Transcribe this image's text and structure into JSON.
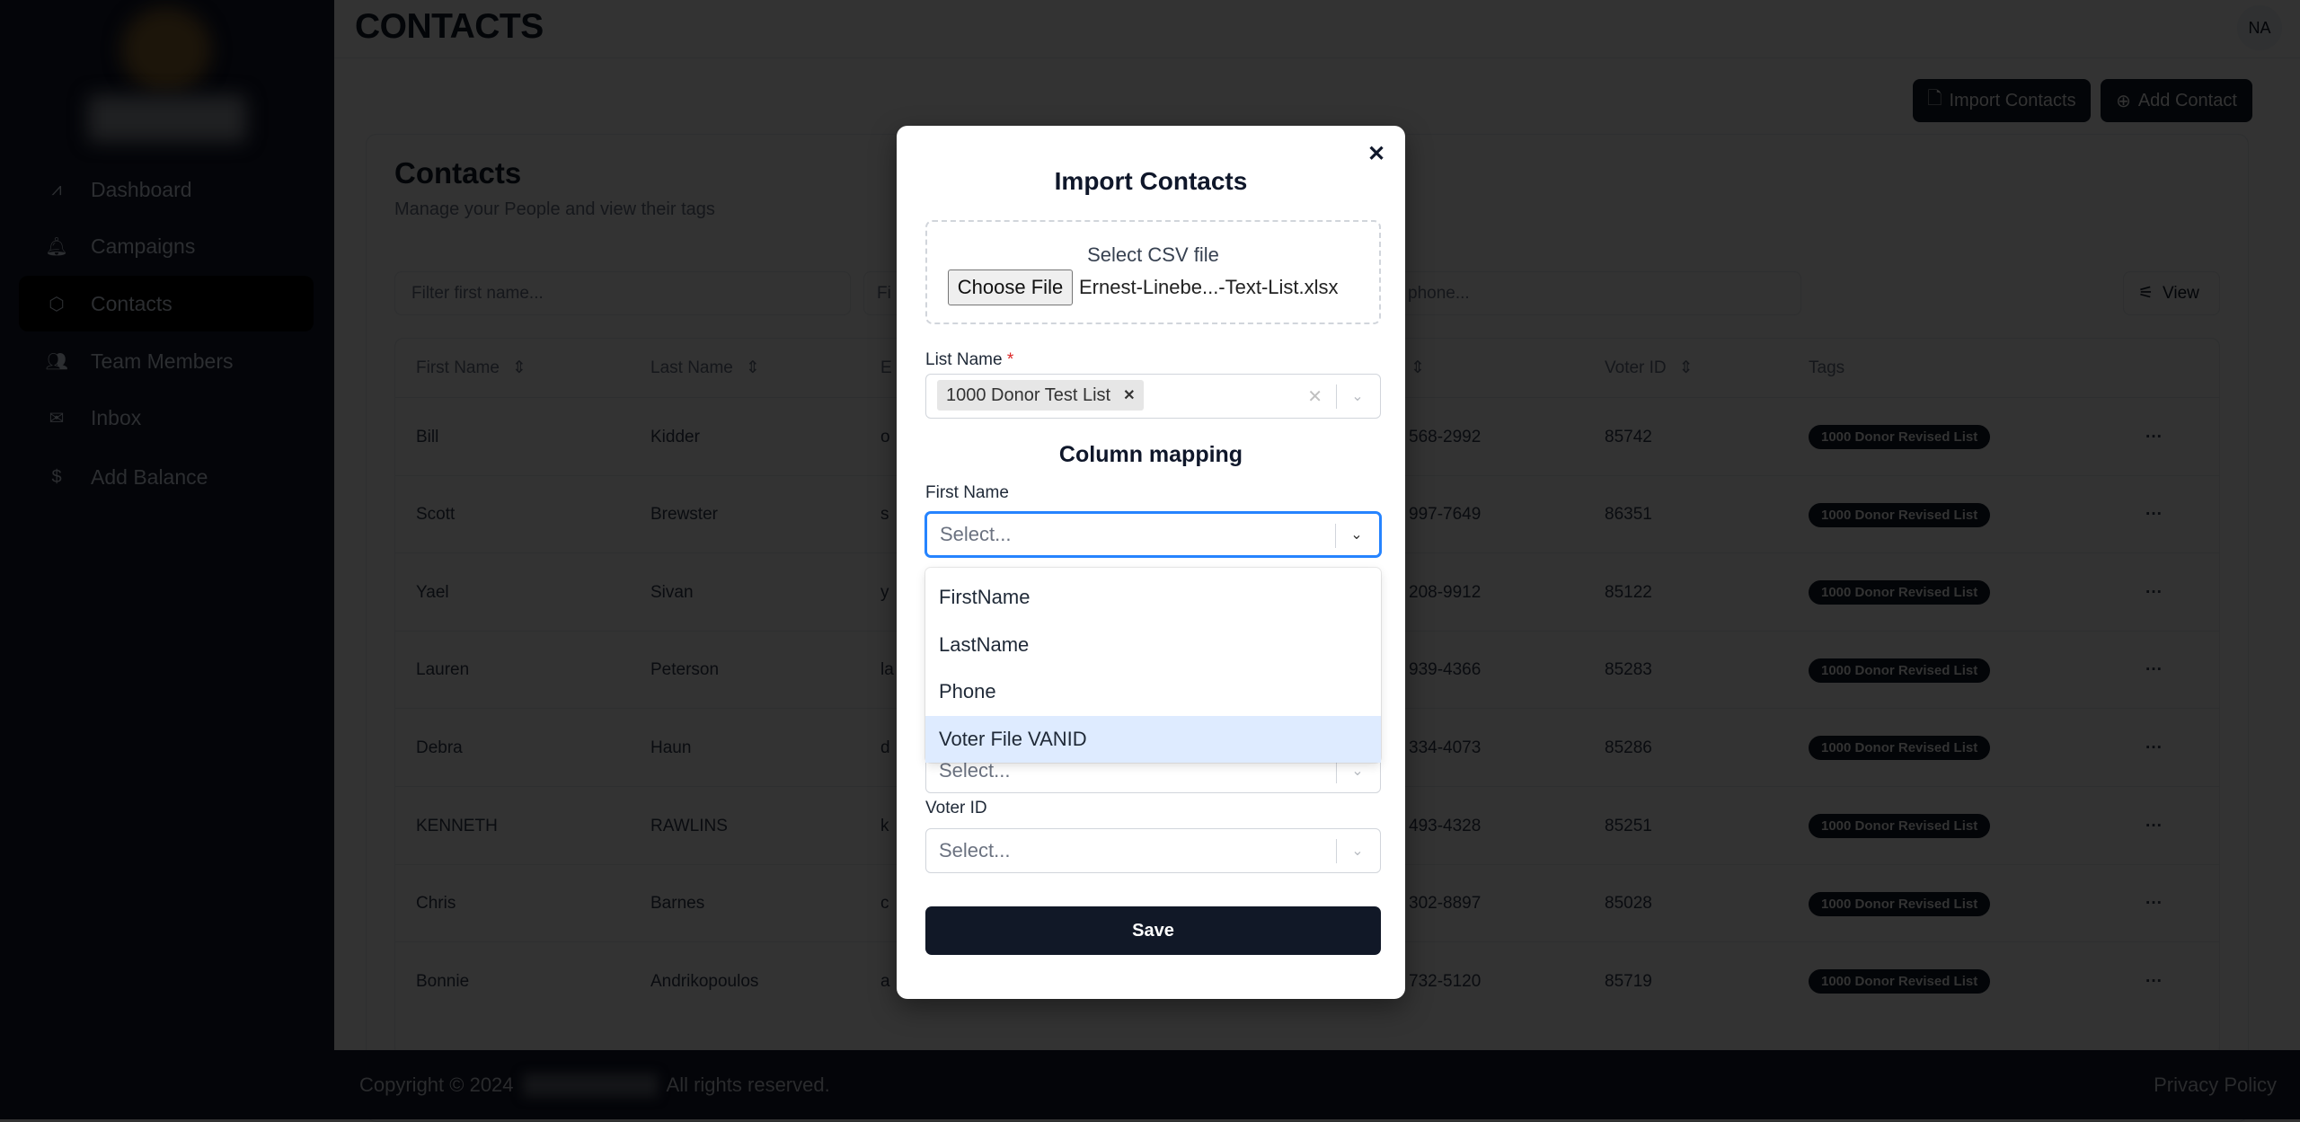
{
  "sidebar": {
    "items": [
      {
        "label": "Dashboard",
        "icon": "chart-line-icon"
      },
      {
        "label": "Campaigns",
        "icon": "bell-icon"
      },
      {
        "label": "Contacts",
        "icon": "box-icon",
        "active": true
      },
      {
        "label": "Team Members",
        "icon": "users-icon"
      },
      {
        "label": "Inbox",
        "icon": "mail-icon"
      },
      {
        "label": "Add Balance",
        "icon": "dollar-icon"
      }
    ]
  },
  "header": {
    "title": "CONTACTS",
    "avatar": "NA"
  },
  "actions": {
    "import": "Import Contacts",
    "add": "Add Contact"
  },
  "card": {
    "title": "Contacts",
    "subtitle": "Manage your People and view their tags"
  },
  "filters": {
    "first": "Filter first name...",
    "second": "Fi",
    "third": "phone...",
    "view": "View"
  },
  "table": {
    "headers": {
      "first": "First Name",
      "last": "Last Name",
      "email": "E",
      "voter": "Voter ID",
      "tags": "Tags"
    },
    "rows": [
      {
        "first": "Bill",
        "last": "Kidder",
        "email": "o",
        "phone": "568-2992",
        "voter": "85742",
        "tag": "1000 Donor Revised List"
      },
      {
        "first": "Scott",
        "last": "Brewster",
        "email": "s",
        "phone": "997-7649",
        "voter": "86351",
        "tag": "1000 Donor Revised List"
      },
      {
        "first": "Yael",
        "last": "Sivan",
        "email": "y",
        "phone": "208-9912",
        "voter": "85122",
        "tag": "1000 Donor Revised List"
      },
      {
        "first": "Lauren",
        "last": "Peterson",
        "email": "la",
        "phone": "939-4366",
        "voter": "85283",
        "tag": "1000 Donor Revised List"
      },
      {
        "first": "Debra",
        "last": "Haun",
        "email": "d",
        "phone": "334-4073",
        "voter": "85286",
        "tag": "1000 Donor Revised List"
      },
      {
        "first": "KENNETH",
        "last": "RAWLINS",
        "email": "k",
        "phone": "493-4328",
        "voter": "85251",
        "tag": "1000 Donor Revised List"
      },
      {
        "first": "Chris",
        "last": "Barnes",
        "email": "c",
        "phone": "302-8897",
        "voter": "85028",
        "tag": "1000 Donor Revised List"
      },
      {
        "first": "Bonnie",
        "last": "Andrikopoulos",
        "email": "a",
        "phone": "732-5120",
        "voter": "85719",
        "tag": "1000 Donor Revised List"
      }
    ]
  },
  "footer": {
    "copyright_pre": "Copyright © 2024",
    "copyright_post": "All rights reserved.",
    "privacy": "Privacy Policy"
  },
  "modal": {
    "title": "Import Contacts",
    "file": {
      "label": "Select CSV file",
      "button": "Choose File",
      "filename": "Ernest-Linebe...-Text-List.xlsx"
    },
    "list_name": {
      "label": "List Name",
      "required": "*",
      "chip": "1000 Donor Test List"
    },
    "mapping_title": "Column mapping",
    "first_name": {
      "label": "First Name",
      "placeholder": "Select..."
    },
    "hidden_select": {
      "placeholder": "Select..."
    },
    "voter_id": {
      "label": "Voter ID",
      "placeholder": "Select..."
    },
    "options": [
      "FirstName",
      "LastName",
      "Phone",
      "Voter File VANID"
    ],
    "highlighted_option": "Voter File VANID",
    "save": "Save"
  },
  "colors": {
    "focus": "#2684ff",
    "highlight": "#deebff",
    "save_bg": "#111827"
  }
}
